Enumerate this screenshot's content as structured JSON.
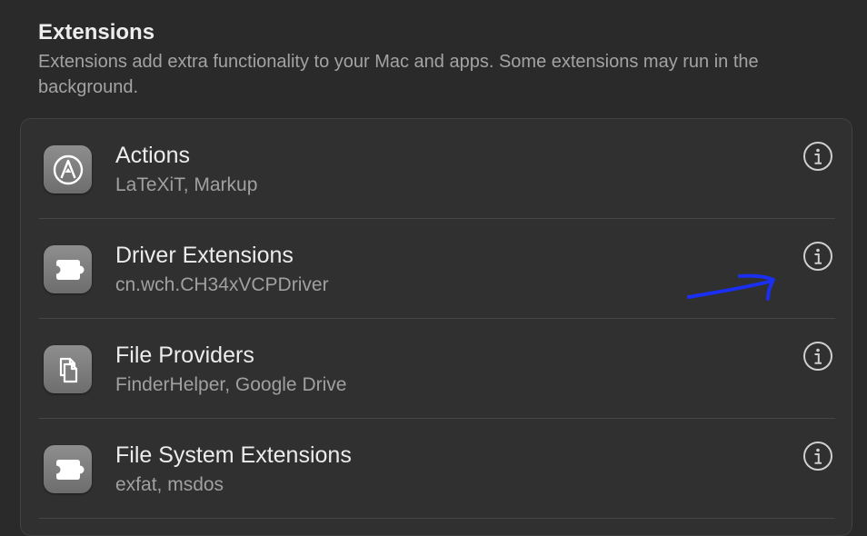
{
  "section": {
    "title": "Extensions",
    "description": "Extensions add extra functionality to your Mac and apps. Some extensions may run in the background."
  },
  "extensions": [
    {
      "title": "Actions",
      "subtitle": "LaTeXiT, Markup",
      "icon": "actions-icon"
    },
    {
      "title": "Driver Extensions",
      "subtitle": "cn.wch.CH34xVCPDriver",
      "icon": "puzzle-piece-icon"
    },
    {
      "title": "File Providers",
      "subtitle": "FinderHelper, Google Drive",
      "icon": "documents-icon"
    },
    {
      "title": "File System Extensions",
      "subtitle": "exfat, msdos",
      "icon": "puzzle-piece-icon"
    }
  ],
  "info_icon": "info-circle-icon",
  "annotation": {
    "icon": "hand-drawn-arrow",
    "color": "#1a2ff0"
  },
  "colors": {
    "background": "#2a2a2a",
    "card": "#303030",
    "icon_tile": "#7c7c7c"
  }
}
